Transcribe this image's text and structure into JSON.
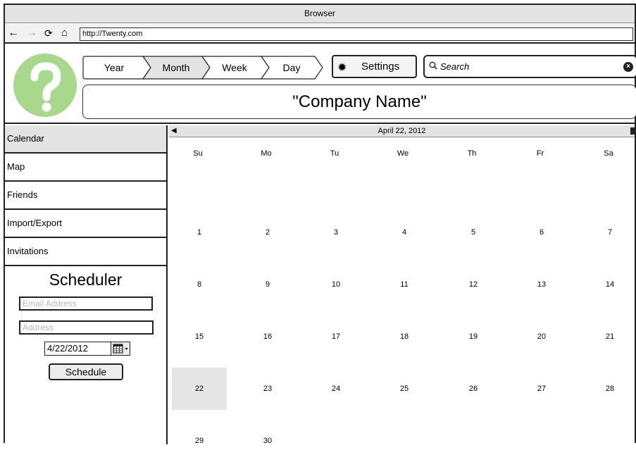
{
  "browser": {
    "title": "Browser",
    "url": "http://Twenty.com"
  },
  "header": {
    "view_tabs": [
      "Year",
      "Month",
      "Week",
      "Day"
    ],
    "settings_label": "Settings",
    "search_placeholder": "Search",
    "company_name": "\"Company Name\""
  },
  "sidebar": {
    "items": [
      {
        "label": "Calendar"
      },
      {
        "label": "Map"
      },
      {
        "label": "Friends"
      },
      {
        "label": "Import/Export"
      },
      {
        "label": "Invitations"
      }
    ],
    "active_index": 0
  },
  "scheduler": {
    "title": "Scheduler",
    "email_placeholder": "Email Address",
    "address_placeholder": "Address",
    "date_value": "4/22/2012",
    "schedule_label": "Schedule"
  },
  "calendar": {
    "month_label": "April 22, 2012",
    "days_of_week": [
      "Su",
      "Mo",
      "Tu",
      "We",
      "Th",
      "Fr",
      "Sa"
    ],
    "weeks": [
      [
        "1",
        "2",
        "3",
        "4",
        "5",
        "6",
        "7"
      ],
      [
        "8",
        "9",
        "10",
        "11",
        "12",
        "13",
        "14"
      ],
      [
        "15",
        "16",
        "17",
        "18",
        "19",
        "20",
        "21"
      ],
      [
        "22",
        "23",
        "24",
        "25",
        "26",
        "27",
        "28"
      ],
      [
        "29",
        "30",
        "",
        "",
        "",
        "",
        ""
      ]
    ],
    "selected_day": "22"
  },
  "colors": {
    "logo": "#a8d88c",
    "selected_day": "#e6e6e6",
    "chrome": "#e3e3e3"
  },
  "icons": [
    "back-arrow-icon",
    "forward-arrow-icon",
    "refresh-icon",
    "home-icon",
    "gear-icon",
    "search-icon",
    "clear-icon",
    "calendar-picker-icon",
    "question-mark-logo"
  ]
}
